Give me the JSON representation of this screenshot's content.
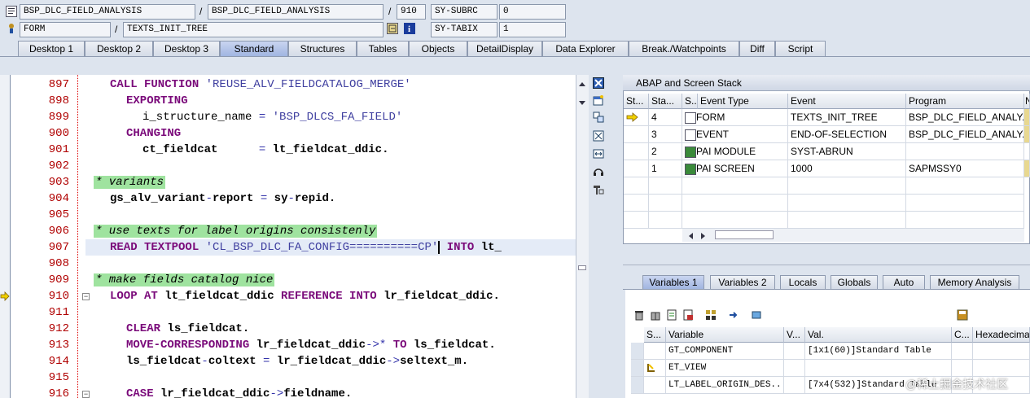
{
  "header": {
    "row1": {
      "program1": "BSP_DLC_FIELD_ANALYSIS",
      "program2": "BSP_DLC_FIELD_ANALYSIS",
      "line": "910",
      "sysvar_label": "SY-SUBRC",
      "sysvar_value": "0"
    },
    "row2": {
      "type": "FORM",
      "event": "TEXTS_INIT_TREE",
      "sysvar_label": "SY-TABIX",
      "sysvar_value": "1"
    },
    "separator": "/"
  },
  "tabs": [
    "Desktop 1",
    "Desktop 2",
    "Desktop 3",
    "Standard",
    "Structures",
    "Tables",
    "Objects",
    "DetailDisplay",
    "Data Explorer",
    "Break./Watchpoints",
    "Diff",
    "Script"
  ],
  "active_tab": "Standard",
  "editor": {
    "lines": [
      {
        "no": "897"
      },
      {
        "no": "898"
      },
      {
        "no": "899"
      },
      {
        "no": "900"
      },
      {
        "no": "901"
      },
      {
        "no": "902"
      },
      {
        "no": "903"
      },
      {
        "no": "904"
      },
      {
        "no": "905"
      },
      {
        "no": "906"
      },
      {
        "no": "907"
      },
      {
        "no": "908"
      },
      {
        "no": "909"
      },
      {
        "no": "910"
      },
      {
        "no": "911"
      },
      {
        "no": "912"
      },
      {
        "no": "913"
      },
      {
        "no": "914"
      },
      {
        "no": "915"
      },
      {
        "no": "916"
      }
    ],
    "code": {
      "l897": {
        "kw": "CALL FUNCTION",
        "str": "'REUSE_ALV_FIELDCATALOG_MERGE'"
      },
      "l898": {
        "kw": "EXPORTING"
      },
      "l899": {
        "a": "i_structure_name",
        "op": "=",
        "str": "'BSP_DLCS_FA_FIELD'"
      },
      "l900": {
        "kw": "CHANGING"
      },
      "l901": {
        "a": "ct_fieldcat",
        "op": "=",
        "b": "lt_fieldcat_ddic."
      },
      "l903": {
        "cmt": "* variants"
      },
      "l904": {
        "a": "gs_alv_variant",
        "op1": "-",
        "b": "report",
        "op": "=",
        "c": "sy",
        "op2": "-",
        "d": "repid."
      },
      "l906": {
        "cmt": "* use texts for label origins consistenly"
      },
      "l907": {
        "kw": "READ TEXTPOOL",
        "str": "'CL_BSP_DLC_FA_CONFIG==========CP'",
        "kw2": "INTO",
        "b": "lt_"
      },
      "l909": {
        "cmt": "* make fields catalog nice"
      },
      "l910": {
        "kw": "LOOP AT",
        "a": "lt_fieldcat_ddic",
        "kw2": "REFERENCE INTO",
        "b": "lr_fieldcat_ddic."
      },
      "l912": {
        "kw": "CLEAR",
        "a": "ls_fieldcat."
      },
      "l913": {
        "kw": "MOVE-CORRESPONDING",
        "a": "lr_fieldcat_ddic",
        "op": "->*",
        "kw2": "TO",
        "b": "ls_fieldcat."
      },
      "l914": {
        "a": "ls_fieldcat",
        "op1": "-",
        "b": "coltext",
        "op": "=",
        "c": "lr_fieldcat_ddic",
        "op2": "->",
        "d": "seltext_m."
      },
      "l916": {
        "kw": "CASE",
        "a": "lr_fieldcat_ddic",
        "op": "->",
        "b": "fieldname."
      }
    }
  },
  "stack": {
    "title": "ABAP and Screen Stack",
    "columns": [
      "St...",
      "Sta...",
      "S...",
      "Event Type",
      "Event",
      "Program",
      "N"
    ],
    "rows": [
      {
        "level": "4",
        "type": "FORM",
        "event": "TEXTS_INIT_TREE",
        "program": "BSP_DLC_FIELD_ANALY..."
      },
      {
        "level": "3",
        "type": "EVENT",
        "event": "END-OF-SELECTION",
        "program": "BSP_DLC_FIELD_ANALY..."
      },
      {
        "level": "2",
        "type": "PAI MODULE",
        "event": "SYST-ABRUN",
        "program": ""
      },
      {
        "level": "1",
        "type": "PAI SCREEN",
        "event": "1000",
        "program": "SAPMSSY0"
      }
    ]
  },
  "var_tabs": [
    "Variables 1",
    "Variables 2",
    "Locals",
    "Globals",
    "Auto",
    "Memory Analysis"
  ],
  "active_var_tab": "Variables 1",
  "variables": {
    "columns": [
      "S...",
      "Variable",
      "V...",
      "Val.",
      "C...",
      "Hexadecimal"
    ],
    "rows": [
      {
        "name": "GT_COMPONENT",
        "value": "[1x1(60)]Standard Table"
      },
      {
        "name": "ET_VIEW",
        "value": ""
      },
      {
        "name": "LT_LABEL_ORIGIN_DES...",
        "value": "[7x4(532)]Standard Table"
      }
    ]
  },
  "watermark": "@稀土掘金技术社区",
  "colors": {
    "keyword": "#7a0a7a",
    "comment_bg": "#9fe39f",
    "line_no": "#b00000",
    "tab_active": "#9eb3e0"
  }
}
